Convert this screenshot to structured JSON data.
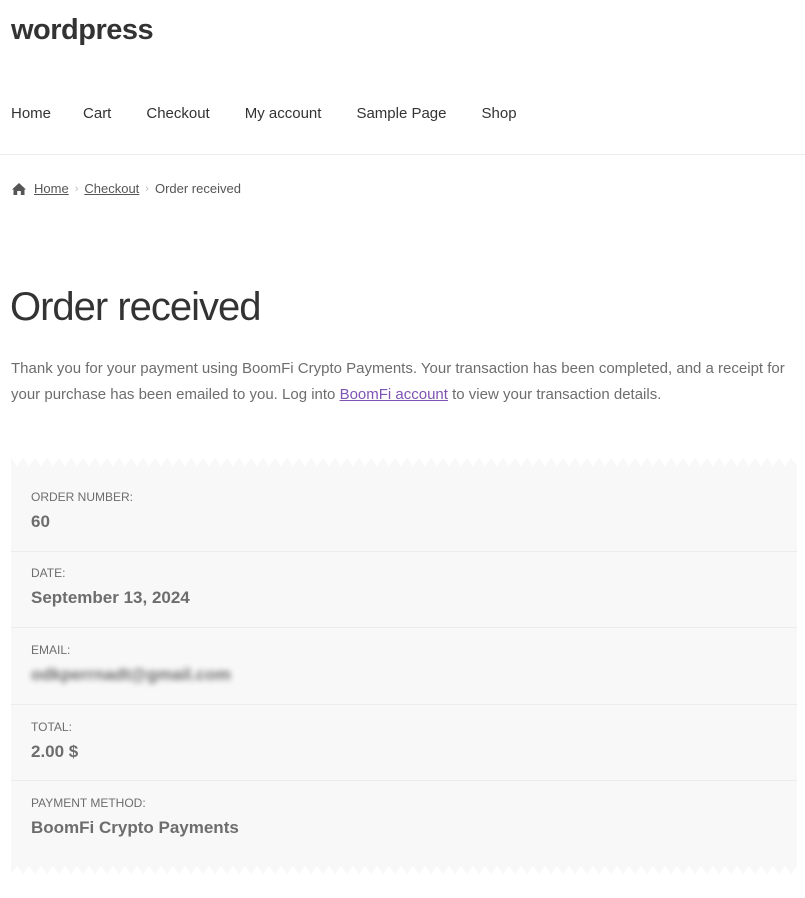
{
  "site": {
    "title": "wordpress"
  },
  "nav": {
    "items": [
      "Home",
      "Cart",
      "Checkout",
      "My account",
      "Sample Page",
      "Shop"
    ]
  },
  "breadcrumb": {
    "home": "Home",
    "checkout": "Checkout",
    "current": "Order received"
  },
  "page": {
    "title": "Order received",
    "thanks_before": "Thank you for your payment using BoomFi Crypto Payments. Your transaction has been completed, and a receipt for your purchase has been emailed to you. Log into ",
    "thanks_link": "BoomFi account",
    "thanks_after": " to view your transaction details."
  },
  "order": {
    "number_label": "ORDER NUMBER:",
    "number_value": "60",
    "date_label": "DATE:",
    "date_value": "September 13, 2024",
    "email_label": "EMAIL:",
    "email_value": "odkperrnadt@gmail.com",
    "total_label": "TOTAL:",
    "total_value": "2.00 $",
    "payment_label": "PAYMENT METHOD:",
    "payment_value": "BoomFi Crypto Payments"
  },
  "colors": {
    "link": "#7f54b3",
    "receipt_bg": "#f8f8f8"
  },
  "icons": {
    "breadcrumb_home": "home-icon"
  }
}
